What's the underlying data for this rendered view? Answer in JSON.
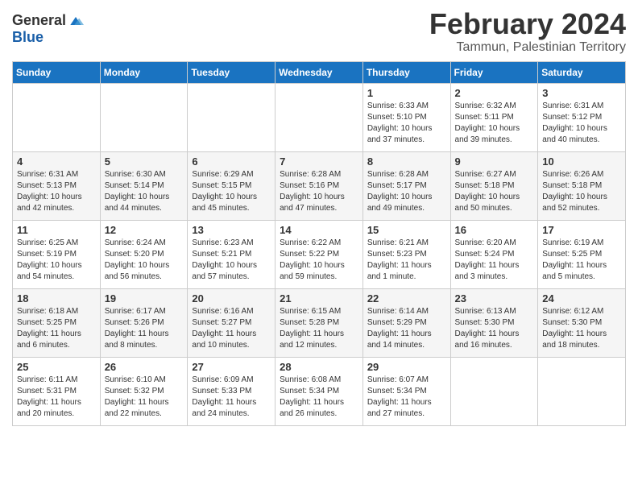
{
  "logo": {
    "general": "General",
    "blue": "Blue"
  },
  "title": "February 2024",
  "location": "Tammun, Palestinian Territory",
  "days_of_week": [
    "Sunday",
    "Monday",
    "Tuesday",
    "Wednesday",
    "Thursday",
    "Friday",
    "Saturday"
  ],
  "weeks": [
    [
      {
        "day": "",
        "sunrise": "",
        "sunset": "",
        "daylight": ""
      },
      {
        "day": "",
        "sunrise": "",
        "sunset": "",
        "daylight": ""
      },
      {
        "day": "",
        "sunrise": "",
        "sunset": "",
        "daylight": ""
      },
      {
        "day": "",
        "sunrise": "",
        "sunset": "",
        "daylight": ""
      },
      {
        "day": "1",
        "sunrise": "Sunrise: 6:33 AM",
        "sunset": "Sunset: 5:10 PM",
        "daylight": "Daylight: 10 hours and 37 minutes."
      },
      {
        "day": "2",
        "sunrise": "Sunrise: 6:32 AM",
        "sunset": "Sunset: 5:11 PM",
        "daylight": "Daylight: 10 hours and 39 minutes."
      },
      {
        "day": "3",
        "sunrise": "Sunrise: 6:31 AM",
        "sunset": "Sunset: 5:12 PM",
        "daylight": "Daylight: 10 hours and 40 minutes."
      }
    ],
    [
      {
        "day": "4",
        "sunrise": "Sunrise: 6:31 AM",
        "sunset": "Sunset: 5:13 PM",
        "daylight": "Daylight: 10 hours and 42 minutes."
      },
      {
        "day": "5",
        "sunrise": "Sunrise: 6:30 AM",
        "sunset": "Sunset: 5:14 PM",
        "daylight": "Daylight: 10 hours and 44 minutes."
      },
      {
        "day": "6",
        "sunrise": "Sunrise: 6:29 AM",
        "sunset": "Sunset: 5:15 PM",
        "daylight": "Daylight: 10 hours and 45 minutes."
      },
      {
        "day": "7",
        "sunrise": "Sunrise: 6:28 AM",
        "sunset": "Sunset: 5:16 PM",
        "daylight": "Daylight: 10 hours and 47 minutes."
      },
      {
        "day": "8",
        "sunrise": "Sunrise: 6:28 AM",
        "sunset": "Sunset: 5:17 PM",
        "daylight": "Daylight: 10 hours and 49 minutes."
      },
      {
        "day": "9",
        "sunrise": "Sunrise: 6:27 AM",
        "sunset": "Sunset: 5:18 PM",
        "daylight": "Daylight: 10 hours and 50 minutes."
      },
      {
        "day": "10",
        "sunrise": "Sunrise: 6:26 AM",
        "sunset": "Sunset: 5:18 PM",
        "daylight": "Daylight: 10 hours and 52 minutes."
      }
    ],
    [
      {
        "day": "11",
        "sunrise": "Sunrise: 6:25 AM",
        "sunset": "Sunset: 5:19 PM",
        "daylight": "Daylight: 10 hours and 54 minutes."
      },
      {
        "day": "12",
        "sunrise": "Sunrise: 6:24 AM",
        "sunset": "Sunset: 5:20 PM",
        "daylight": "Daylight: 10 hours and 56 minutes."
      },
      {
        "day": "13",
        "sunrise": "Sunrise: 6:23 AM",
        "sunset": "Sunset: 5:21 PM",
        "daylight": "Daylight: 10 hours and 57 minutes."
      },
      {
        "day": "14",
        "sunrise": "Sunrise: 6:22 AM",
        "sunset": "Sunset: 5:22 PM",
        "daylight": "Daylight: 10 hours and 59 minutes."
      },
      {
        "day": "15",
        "sunrise": "Sunrise: 6:21 AM",
        "sunset": "Sunset: 5:23 PM",
        "daylight": "Daylight: 11 hours and 1 minute."
      },
      {
        "day": "16",
        "sunrise": "Sunrise: 6:20 AM",
        "sunset": "Sunset: 5:24 PM",
        "daylight": "Daylight: 11 hours and 3 minutes."
      },
      {
        "day": "17",
        "sunrise": "Sunrise: 6:19 AM",
        "sunset": "Sunset: 5:25 PM",
        "daylight": "Daylight: 11 hours and 5 minutes."
      }
    ],
    [
      {
        "day": "18",
        "sunrise": "Sunrise: 6:18 AM",
        "sunset": "Sunset: 5:25 PM",
        "daylight": "Daylight: 11 hours and 6 minutes."
      },
      {
        "day": "19",
        "sunrise": "Sunrise: 6:17 AM",
        "sunset": "Sunset: 5:26 PM",
        "daylight": "Daylight: 11 hours and 8 minutes."
      },
      {
        "day": "20",
        "sunrise": "Sunrise: 6:16 AM",
        "sunset": "Sunset: 5:27 PM",
        "daylight": "Daylight: 11 hours and 10 minutes."
      },
      {
        "day": "21",
        "sunrise": "Sunrise: 6:15 AM",
        "sunset": "Sunset: 5:28 PM",
        "daylight": "Daylight: 11 hours and 12 minutes."
      },
      {
        "day": "22",
        "sunrise": "Sunrise: 6:14 AM",
        "sunset": "Sunset: 5:29 PM",
        "daylight": "Daylight: 11 hours and 14 minutes."
      },
      {
        "day": "23",
        "sunrise": "Sunrise: 6:13 AM",
        "sunset": "Sunset: 5:30 PM",
        "daylight": "Daylight: 11 hours and 16 minutes."
      },
      {
        "day": "24",
        "sunrise": "Sunrise: 6:12 AM",
        "sunset": "Sunset: 5:30 PM",
        "daylight": "Daylight: 11 hours and 18 minutes."
      }
    ],
    [
      {
        "day": "25",
        "sunrise": "Sunrise: 6:11 AM",
        "sunset": "Sunset: 5:31 PM",
        "daylight": "Daylight: 11 hours and 20 minutes."
      },
      {
        "day": "26",
        "sunrise": "Sunrise: 6:10 AM",
        "sunset": "Sunset: 5:32 PM",
        "daylight": "Daylight: 11 hours and 22 minutes."
      },
      {
        "day": "27",
        "sunrise": "Sunrise: 6:09 AM",
        "sunset": "Sunset: 5:33 PM",
        "daylight": "Daylight: 11 hours and 24 minutes."
      },
      {
        "day": "28",
        "sunrise": "Sunrise: 6:08 AM",
        "sunset": "Sunset: 5:34 PM",
        "daylight": "Daylight: 11 hours and 26 minutes."
      },
      {
        "day": "29",
        "sunrise": "Sunrise: 6:07 AM",
        "sunset": "Sunset: 5:34 PM",
        "daylight": "Daylight: 11 hours and 27 minutes."
      },
      {
        "day": "",
        "sunrise": "",
        "sunset": "",
        "daylight": ""
      },
      {
        "day": "",
        "sunrise": "",
        "sunset": "",
        "daylight": ""
      }
    ]
  ]
}
